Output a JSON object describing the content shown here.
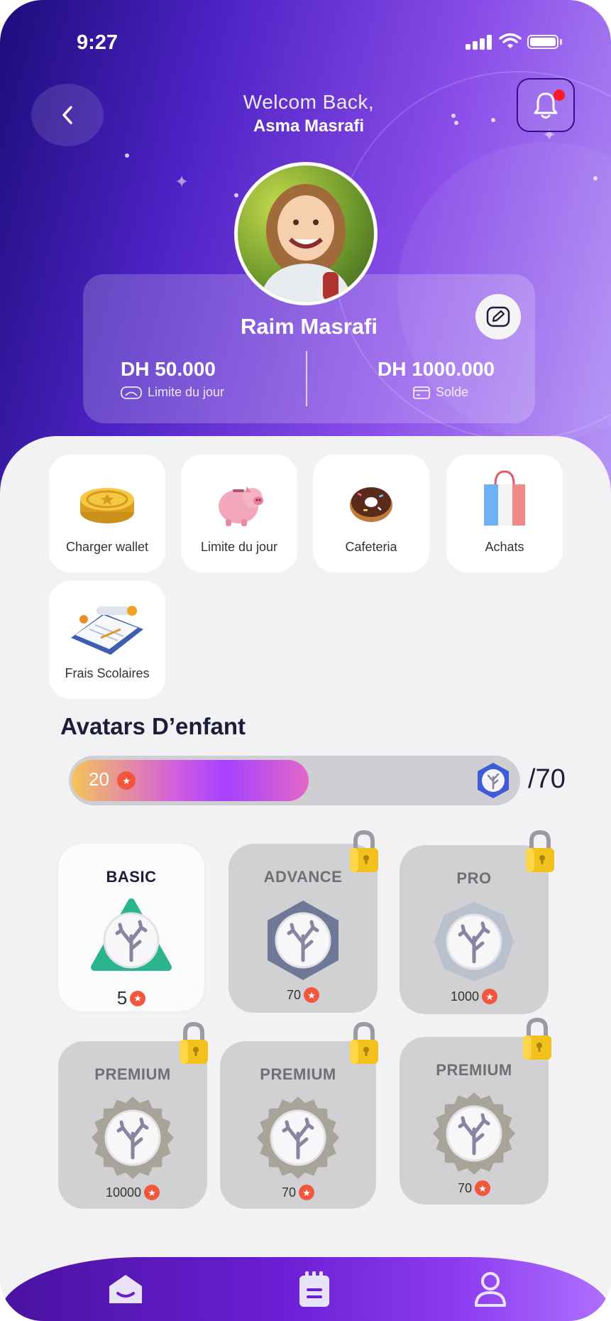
{
  "status_bar": {
    "time": "9:27"
  },
  "header": {
    "welcome": "Welcom Back,",
    "parent_name": "Asma Masrafi"
  },
  "profile": {
    "child_name": "Raim Masrafi",
    "daily_limit": {
      "amount": "DH 50.000",
      "label": "Limite du jour"
    },
    "balance": {
      "amount": "DH 1000.000",
      "label": "Solde"
    }
  },
  "actions": [
    {
      "label": "Charger wallet",
      "icon": "gold-coin-icon"
    },
    {
      "label": "Limite du jour",
      "icon": "piggy-bank-icon"
    },
    {
      "label": "Cafeteria",
      "icon": "donut-icon"
    },
    {
      "label": "Achats",
      "icon": "shopping-bag-icon"
    },
    {
      "label": "Frais Scolaires",
      "icon": "school-fees-icon"
    }
  ],
  "avatars": {
    "title": "Avatars D’enfant",
    "progress": {
      "value": "20",
      "total": "/70",
      "fraction": 0.4
    },
    "badges": [
      {
        "title": "BASIC",
        "cost": "5",
        "locked": false,
        "color": "#2bb58f"
      },
      {
        "title": "ADVANCE",
        "cost": "70",
        "locked": true,
        "color": "#6f7896"
      },
      {
        "title": "PRO",
        "cost": "1000",
        "locked": true,
        "color": "#b9c1cf"
      },
      {
        "title": "PREMIUM",
        "cost": "10000",
        "locked": true,
        "color": "#a8a49a"
      },
      {
        "title": "PREMIUM",
        "cost": "70",
        "locked": true,
        "color": "#a8a49a"
      },
      {
        "title": "PREMIUM",
        "cost": "70",
        "locked": true,
        "color": "#a8a49a"
      }
    ]
  },
  "tabbar": [
    {
      "name": "home-icon"
    },
    {
      "name": "calendar-icon"
    },
    {
      "name": "profile-icon"
    }
  ]
}
